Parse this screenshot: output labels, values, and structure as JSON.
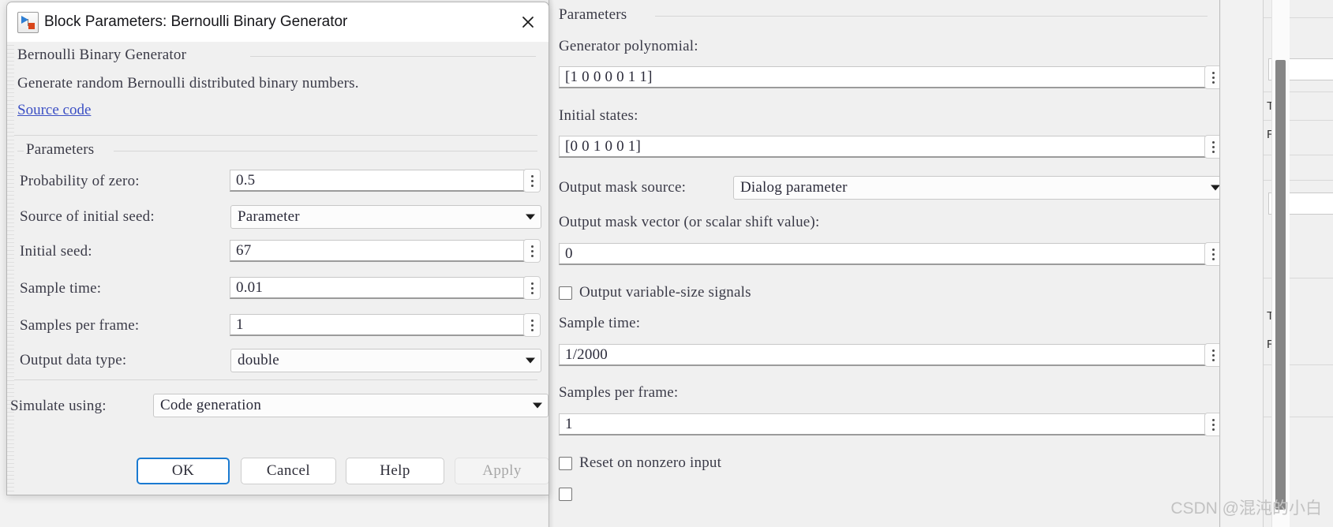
{
  "background_window": {
    "name": "partially-visible-window-behind",
    "fragment_labels": [
      "T",
      "R",
      "T",
      "R"
    ],
    "scrollbar": "vertical-scrollbar"
  },
  "left_dialog": {
    "icon": "simulink-block-icon",
    "title": "Block Parameters: Bernoulli Binary Generator",
    "close_label": "close-icon",
    "description": {
      "group_title": "Bernoulli Binary Generator",
      "text": "Generate random Bernoulli distributed binary numbers.",
      "link": "Source code"
    },
    "parameters_group_title": "Parameters",
    "fields": [
      {
        "label": "Probability of zero:",
        "value": "0.5",
        "control": "text-with-spinner"
      },
      {
        "label": "Source of initial seed:",
        "value": "Parameter",
        "control": "combobox"
      },
      {
        "label": "Initial seed:",
        "value": "67",
        "control": "text-with-spinner"
      },
      {
        "label": "Sample time:",
        "value": "0.01",
        "control": "text-with-spinner"
      },
      {
        "label": "Samples per frame:",
        "value": "1",
        "control": "text-with-spinner"
      },
      {
        "label": "Output data type:",
        "value": "double",
        "control": "combobox"
      }
    ],
    "simulate_using": {
      "label": "Simulate using:",
      "value": "Code generation",
      "control": "combobox"
    },
    "buttons": [
      {
        "label": "OK",
        "state": "default-focused"
      },
      {
        "label": "Cancel",
        "state": "normal"
      },
      {
        "label": "Help",
        "state": "normal"
      },
      {
        "label": "Apply",
        "state": "disabled"
      }
    ]
  },
  "right_panel": {
    "group_title": "Parameters",
    "generator_polynomial": {
      "label": "Generator polynomial:",
      "value": "[1 0 0 0 0 1 1]"
    },
    "initial_states": {
      "label": "Initial states:",
      "value": "[0 0 1 0 0 1]"
    },
    "output_mask_source": {
      "label": "Output mask source:",
      "value": "Dialog parameter"
    },
    "output_mask_vector": {
      "label": "Output mask vector (or scalar shift value):",
      "value": "0"
    },
    "output_variable_size": {
      "label": "Output variable-size signals",
      "checked": false
    },
    "sample_time": {
      "label": "Sample time:",
      "value": "1/2000"
    },
    "samples_per_frame": {
      "label": "Samples per frame:",
      "value": "1"
    },
    "reset_on_nonzero": {
      "label": "Reset on nonzero input",
      "checked": false
    }
  },
  "watermark": "CSDN @混沌的小白",
  "colors": {
    "accent_blue": "#1a7ad1",
    "link_blue": "#3b4fc4",
    "panel_bg": "#f0f0f0",
    "field_bg": "#ffffff",
    "text": "#3b3b48"
  }
}
